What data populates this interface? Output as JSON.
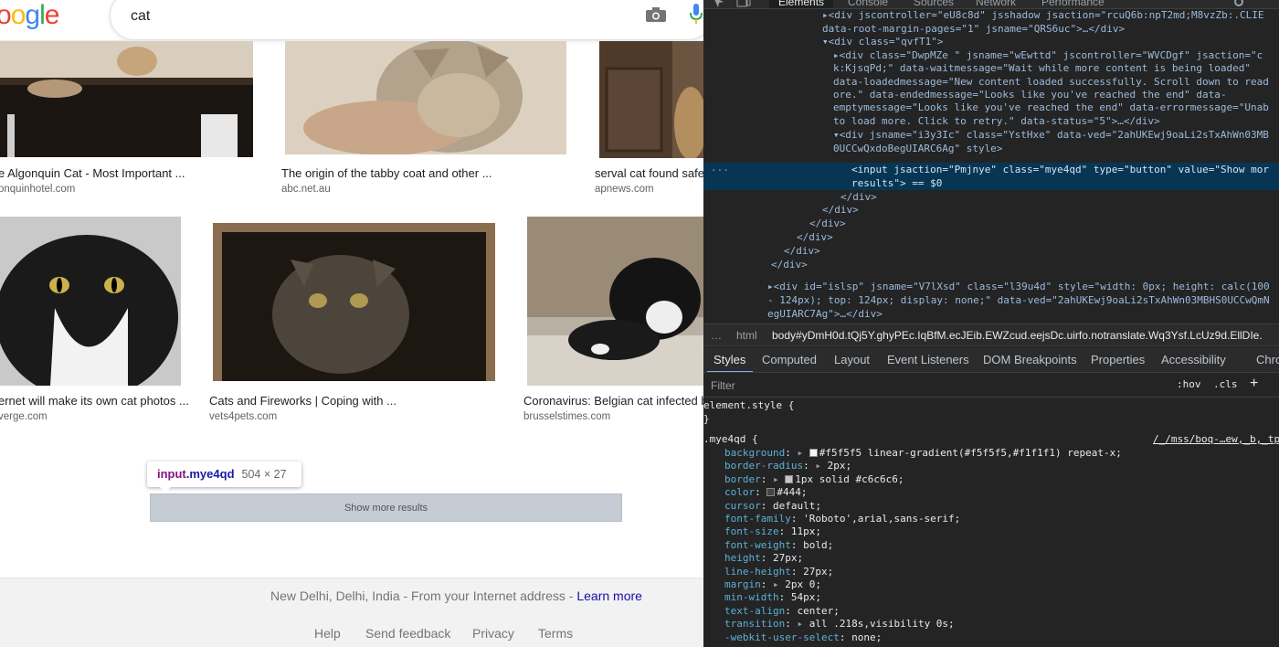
{
  "google": {
    "logo": "oogle",
    "query": "cat",
    "results": [
      {
        "title": "e Algonquin Cat - Most Important ...",
        "source": "onquinhotel.com"
      },
      {
        "title": "The origin of the tabby coat and other ...",
        "source": "abc.net.au"
      },
      {
        "title": "serval cat found safe",
        "source": "apnews.com"
      },
      {
        "title": "ernet will make its own cat photos ...",
        "source": "verge.com"
      },
      {
        "title": "Cats and Fireworks | Coping with ...",
        "source": "vets4pets.com"
      },
      {
        "title": "Coronavirus: Belgian cat infected b",
        "source": "brusselstimes.com"
      }
    ],
    "tooltip": {
      "tag": "input",
      "cls": ".mye4qd",
      "size": "504 × 27"
    },
    "show_more": "Show more results",
    "location_text": "New Delhi, Delhi, India - From your Internet address - ",
    "learn_more": "Learn more",
    "footer_links": [
      "Help",
      "Send feedback",
      "Privacy",
      "Terms"
    ]
  },
  "devtools": {
    "top_tabs": [
      "Elements",
      "Console",
      "Sources",
      "Network",
      "Performance"
    ],
    "active_tab": "Elements",
    "code_lines": [
      "▸<div jscontroller=\"eU8c8d\" jsshadow jsaction=\"rcuQ6b:npT2md;M8vzZb:.CLIE",
      "  data-root-margin-pages=\"1\" jsname=\"QRS6uc\">…</div>",
      "▾<div class=\"qvfT1\">",
      "  ▸<div class=\"DwpMZe \" jsname=\"wEwttd\" jscontroller=\"WVCDgf\" jsaction=\"c",
      "  k:KjsqPd;\" data-waitmessage=\"Wait while more content is being loaded\"",
      "  data-loadedmessage=\"New content loaded successfully. Scroll down to read",
      "  ore.\" data-endedmessage=\"Looks like you've reached the end\" data-",
      "  emptymessage=\"Looks like you've reached the end\" data-errormessage=\"Unab",
      "  to load more. Click to retry.\" data-status=\"5\">…</div>",
      "  ▾<div jsname=\"i3y3Ic\" class=\"YstHxe\" data-ved=\"2ahUKEwj9oaLi2sTxAhWn03MB",
      "  0UCCwQxdoBegUIARC6Ag\" style>",
      "      <input jsaction=\"Pmjnye\" class=\"mye4qd\" type=\"button\" value=\"Show mor",
      "      results\"> == $0",
      "    </div>",
      "   </div>",
      "  </div>",
      " </div>",
      "</div>",
      "</div>",
      "▸<div id=\"islsp\" jsname=\"V7lXsd\" class=\"l39u4d\" style=\"width: 0px; height: calc(100",
      "  - 124px); top: 124px; display: none;\" data-ved=\"2ahUKEwj9oaLi2sTxAhWn03MBHS0UCCwQmN",
      "  egUIARC7Ag\">…</div>"
    ],
    "breadcrumb": [
      "…",
      "html",
      "body#yDmH0d.tQj5Y.ghyPEc.IqBfM.ecJEib.EWZcud.eejsDc.uirfo.notranslate.Wq3Ysf.LcUz9d.EllDIe."
    ],
    "style_tabs": [
      "Styles",
      "Computed",
      "Layout",
      "Event Listeners",
      "DOM Breakpoints",
      "Properties",
      "Accessibility",
      "ChroPa"
    ],
    "filter_placeholder": "Filter",
    "hov": ":hov",
    "cls": ".cls",
    "element_style_open": "element.style {",
    "element_style_close": "}",
    "rule_selector": ".mye4qd {",
    "rule_source": "/_/mss/boq-…ew,_b,_tp",
    "properties": [
      {
        "name": "background",
        "value": "#f5f5f5 linear-gradient(#f5f5f5,#f1f1f1) repeat-x;",
        "arrow": true,
        "swatch": "#f5f5f5"
      },
      {
        "name": "border-radius",
        "value": "2px;",
        "arrow": true
      },
      {
        "name": "border",
        "value": "1px solid #c6c6c6;",
        "arrow": true,
        "swatch": "#c6c6c6"
      },
      {
        "name": "color",
        "value": "#444;",
        "swatch": "#444444"
      },
      {
        "name": "cursor",
        "value": "default;"
      },
      {
        "name": "font-family",
        "value": "'Roboto',arial,sans-serif;"
      },
      {
        "name": "font-size",
        "value": "11px;"
      },
      {
        "name": "font-weight",
        "value": "bold;"
      },
      {
        "name": "height",
        "value": "27px;"
      },
      {
        "name": "line-height",
        "value": "27px;"
      },
      {
        "name": "margin",
        "value": "2px 0;",
        "arrow": true
      },
      {
        "name": "min-width",
        "value": "54px;"
      },
      {
        "name": "text-align",
        "value": "center;"
      },
      {
        "name": "transition",
        "value": "all .218s,visibility 0s;",
        "arrow": true
      },
      {
        "name": "-webkit-user-select",
        "value": "none;"
      }
    ]
  }
}
